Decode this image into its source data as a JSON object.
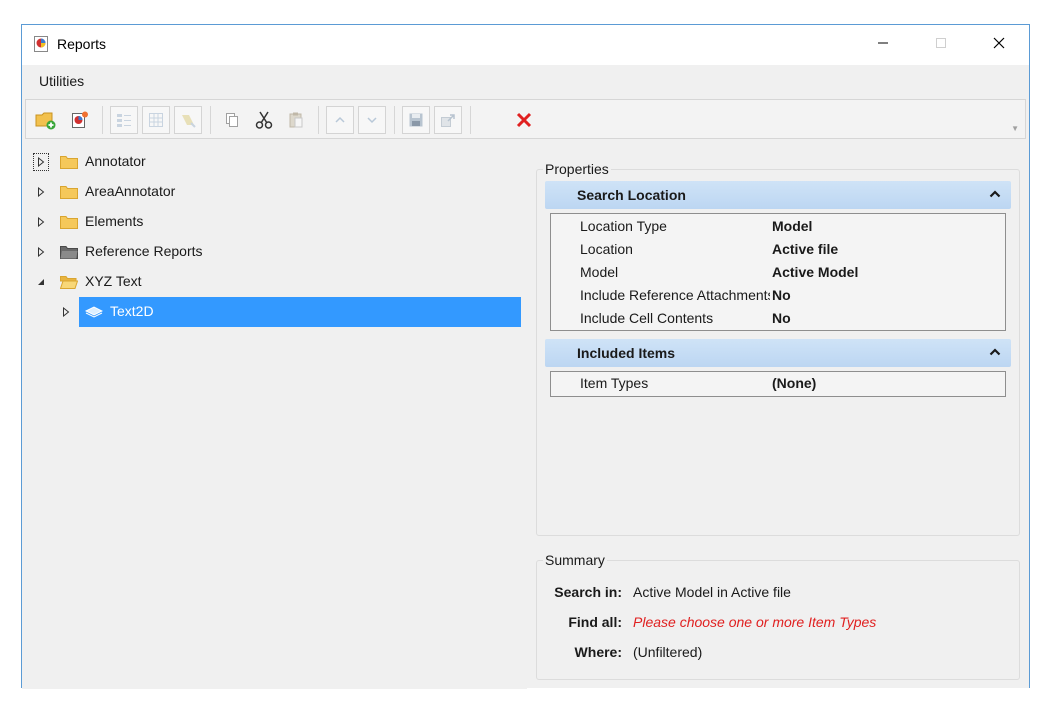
{
  "window": {
    "title": "Reports",
    "controls": {
      "minimize": "minimize-icon",
      "maximize": "maximize-icon",
      "close": "close-icon"
    }
  },
  "menu": {
    "items": [
      "Utilities"
    ]
  },
  "toolbar": {
    "buttons": [
      {
        "icon": "add-folder-icon",
        "enabled": true
      },
      {
        "icon": "new-report-icon",
        "enabled": true
      },
      {
        "icon": "columns-icon",
        "enabled": false
      },
      {
        "icon": "table-icon",
        "enabled": false
      },
      {
        "icon": "highlight-icon",
        "enabled": false
      },
      {
        "icon": "copy-icon",
        "enabled": false
      },
      {
        "icon": "cut-icon",
        "enabled": true
      },
      {
        "icon": "paste-icon",
        "enabled": false
      },
      {
        "icon": "move-up-icon",
        "enabled": false
      },
      {
        "icon": "move-down-icon",
        "enabled": false
      },
      {
        "icon": "save-icon",
        "enabled": false
      },
      {
        "icon": "export-icon",
        "enabled": false
      },
      {
        "icon": "delete-icon",
        "enabled": true
      }
    ],
    "delete_color": "#e02020"
  },
  "tree": {
    "items": [
      {
        "label": "Annotator",
        "expander": "collapsed",
        "icon": "folder-icon"
      },
      {
        "label": "AreaAnnotator",
        "expander": "collapsed",
        "icon": "folder-icon"
      },
      {
        "label": "Elements",
        "expander": "collapsed",
        "icon": "folder-icon"
      },
      {
        "label": "Reference Reports",
        "expander": "collapsed",
        "icon": "folder-dark-icon"
      },
      {
        "label": "XYZ Text",
        "expander": "expanded",
        "icon": "folder-open-icon"
      },
      {
        "label": "Text2D",
        "expander": "collapsed",
        "icon": "report-icon",
        "selected": true
      }
    ],
    "selection_color": "#3399ff"
  },
  "properties": {
    "title": "Properties",
    "search_location": {
      "title": "Search Location",
      "rows": [
        {
          "name": "Location Type",
          "value": "Model"
        },
        {
          "name": "Location",
          "value": "Active file"
        },
        {
          "name": "Model",
          "value": "Active Model"
        },
        {
          "name": "Include Reference Attachments",
          "value": "No"
        },
        {
          "name": "Include Cell Contents",
          "value": "No"
        }
      ]
    },
    "included_items": {
      "title": "Included Items",
      "rows": [
        {
          "name": "Item Types",
          "value": "(None)"
        }
      ]
    }
  },
  "summary": {
    "title": "Summary",
    "search_in_label": "Search in:",
    "search_in_value": "Active Model  in Active file",
    "find_all_label": "Find all:",
    "find_all_value": "Please choose one or more Item Types",
    "where_label": "Where:",
    "where_value": "(Unfiltered)",
    "warning_color": "#e02020"
  }
}
